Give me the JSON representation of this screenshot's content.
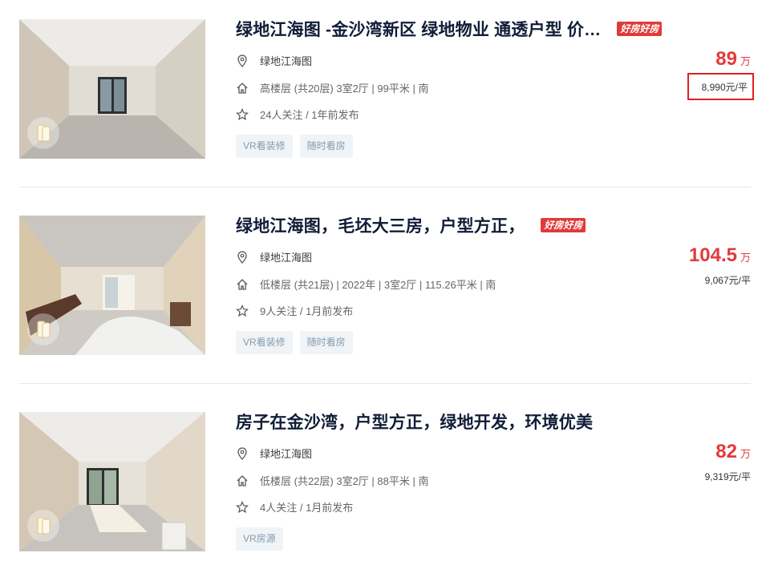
{
  "listings": [
    {
      "title": "绿地江海图 -金沙湾新区 绿地物业 通透户型 价…",
      "badge": "好房好房",
      "location": "绿地江海图",
      "house_info": "高楼层 (共20层) 3室2厅 | 99平米 | 南",
      "follow_info": "24人关注 / 1年前发布",
      "tags": [
        "VR看装修",
        "随时看房"
      ],
      "total_price": "89",
      "total_unit": "万",
      "unit_price": "8,990元/平"
    },
    {
      "title": "绿地江海图，毛坯大三房，户型方正，",
      "badge": "好房好房",
      "location": "绿地江海图",
      "house_info": "低楼层 (共21层) | 2022年 | 3室2厅 | 115.26平米 | 南",
      "follow_info": "9人关注 / 1月前发布",
      "tags": [
        "VR看装修",
        "随时看房"
      ],
      "total_price": "104.5",
      "total_unit": "万",
      "unit_price": "9,067元/平"
    },
    {
      "title": "房子在金沙湾，户型方正，绿地开发，环境优美",
      "location": "绿地江海图",
      "house_info": "低楼层 (共22层) 3室2厅 | 88平米 | 南",
      "follow_info": "4人关注 / 1月前发布",
      "tags": [
        "VR房源"
      ],
      "total_price": "82",
      "total_unit": "万",
      "unit_price": "9,319元/平"
    }
  ],
  "colors": {
    "price_red": "#e4393c",
    "title_navy": "#101d37",
    "tag_bg": "#f0f4f7",
    "tag_text": "#849aae",
    "highlight_box": "#e02020"
  },
  "icons": [
    "location-pin-icon",
    "house-icon",
    "star-icon",
    "vr-icon"
  ]
}
